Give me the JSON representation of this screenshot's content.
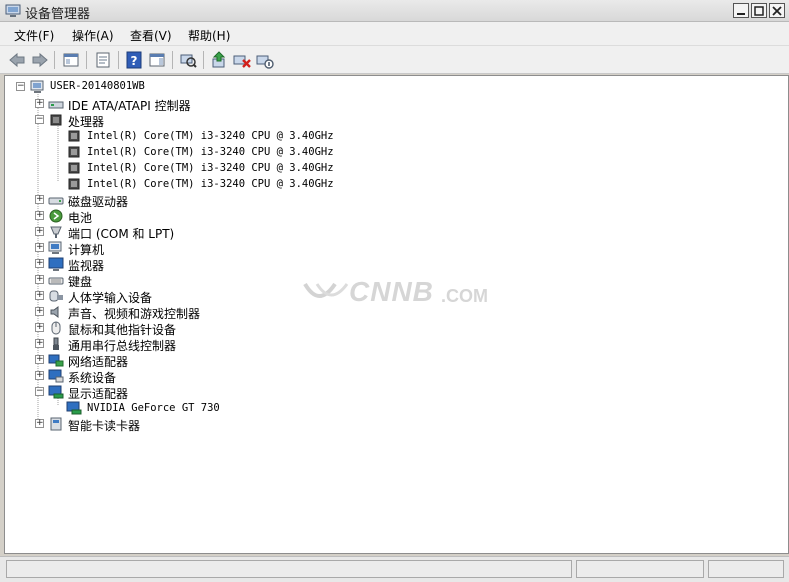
{
  "window": {
    "title": "设备管理器",
    "controls": [
      "minimize",
      "maximize",
      "close"
    ]
  },
  "menu": [
    {
      "label": "文件(F)"
    },
    {
      "label": "操作(A)"
    },
    {
      "label": "查看(V)"
    },
    {
      "label": "帮助(H)"
    }
  ],
  "toolbar": {
    "buttons": [
      "back-arrow-icon",
      "forward-arrow-icon",
      "console-tree-icon",
      "properties-icon",
      "help-icon",
      "action-pane-icon",
      "scan-hardware-icon",
      "update-driver-icon",
      "uninstall-icon",
      "disable-icon"
    ]
  },
  "tree": {
    "root": "USER-20140801WB",
    "nodes": [
      {
        "label": "IDE ATA/ATAPI 控制器",
        "expanded": false,
        "icon": "ide-controller-icon"
      },
      {
        "label": "处理器",
        "expanded": true,
        "icon": "processor-icon",
        "children": [
          "Intel(R) Core(TM) i3-3240 CPU @ 3.40GHz",
          "Intel(R) Core(TM) i3-3240 CPU @ 3.40GHz",
          "Intel(R) Core(TM) i3-3240 CPU @ 3.40GHz",
          "Intel(R) Core(TM) i3-3240 CPU @ 3.40GHz"
        ]
      },
      {
        "label": "磁盘驱动器",
        "expanded": false,
        "icon": "disk-drive-icon"
      },
      {
        "label": "电池",
        "expanded": false,
        "icon": "battery-icon"
      },
      {
        "label": "端口 (COM 和 LPT)",
        "expanded": false,
        "icon": "port-icon"
      },
      {
        "label": "计算机",
        "expanded": false,
        "icon": "computer-icon"
      },
      {
        "label": "监视器",
        "expanded": false,
        "icon": "monitor-icon"
      },
      {
        "label": "键盘",
        "expanded": false,
        "icon": "keyboard-icon"
      },
      {
        "label": "人体学输入设备",
        "expanded": false,
        "icon": "hid-icon"
      },
      {
        "label": "声音、视频和游戏控制器",
        "expanded": false,
        "icon": "sound-icon"
      },
      {
        "label": "鼠标和其他指针设备",
        "expanded": false,
        "icon": "mouse-icon"
      },
      {
        "label": "通用串行总线控制器",
        "expanded": false,
        "icon": "usb-icon"
      },
      {
        "label": "网络适配器",
        "expanded": false,
        "icon": "network-adapter-icon"
      },
      {
        "label": "系统设备",
        "expanded": false,
        "icon": "system-device-icon"
      },
      {
        "label": "显示适配器",
        "expanded": true,
        "icon": "display-adapter-icon",
        "children": [
          "NVIDIA GeForce GT 730"
        ]
      },
      {
        "label": "智能卡读卡器",
        "expanded": false,
        "icon": "smart-card-reader-icon"
      }
    ]
  },
  "watermark": {
    "brand": "CNNB",
    "suffix": ".COM"
  }
}
